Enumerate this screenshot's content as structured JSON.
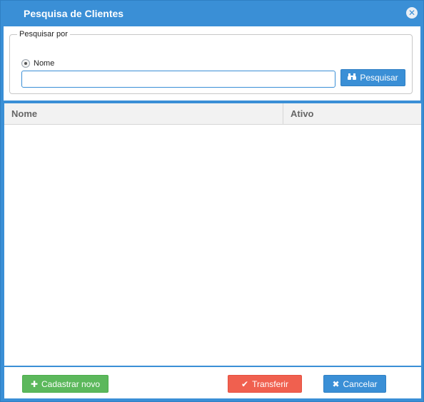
{
  "dialog": {
    "title": "Pesquisa de Clientes",
    "close_icon": "close-icon"
  },
  "search": {
    "group_label": "Pesquisar por",
    "radio_option": "Nome",
    "radio_selected": true,
    "input_value": "",
    "input_placeholder": "",
    "button_label": "Pesquisar",
    "button_icon": "binoculars-icon"
  },
  "grid": {
    "columns": [
      "Nome",
      "Ativo"
    ],
    "rows": []
  },
  "footer": {
    "new_label": "Cadastrar novo",
    "new_icon": "plus-icon",
    "transfer_label": "Transferir",
    "transfer_icon": "check-icon",
    "cancel_label": "Cancelar",
    "cancel_icon": "x-icon"
  },
  "colors": {
    "primary": "#3a8fd6",
    "success": "#5cb85c",
    "danger": "#f0604f"
  }
}
